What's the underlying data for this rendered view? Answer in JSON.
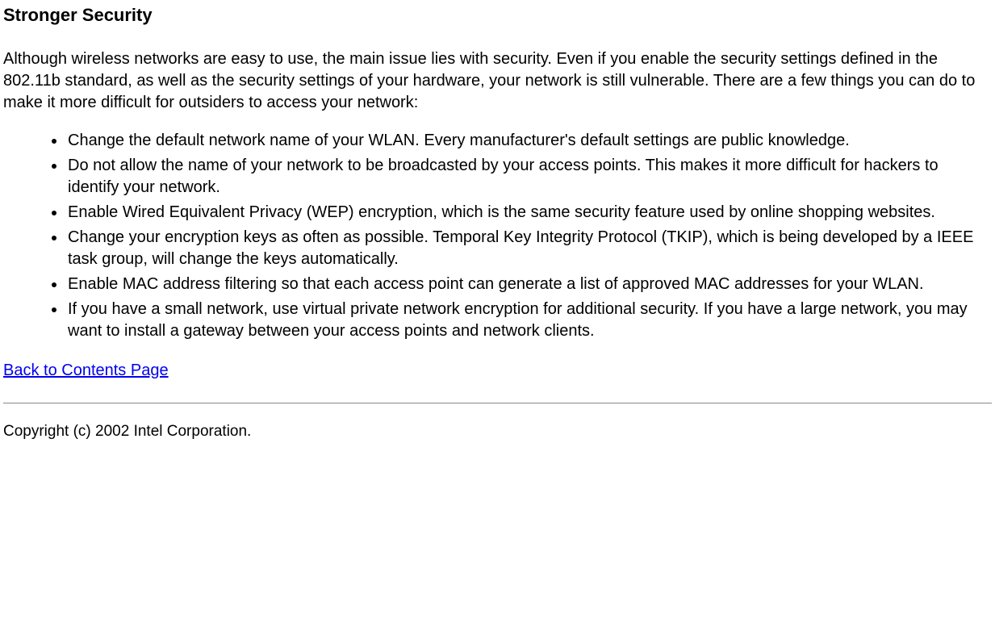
{
  "heading": "Stronger Security",
  "intro": "Although wireless networks are easy to use, the main issue lies with security. Even if you enable the security settings defined in the 802.11b standard, as well as the security settings of your hardware, your network is still vulnerable. There are a few things you can do to make it more difficult for outsiders to access your network:",
  "bullets": [
    "Change the default network name of your WLAN. Every manufacturer's default settings are public knowledge.",
    "Do not allow the name of your network to be broadcasted by your access points. This makes it more difficult for hackers to identify your network.",
    "Enable Wired Equivalent Privacy (WEP) encryption, which is the same security feature used by online shopping websites.",
    "Change your encryption keys as often as possible. Temporal Key Integrity Protocol (TKIP), which is being developed by a IEEE task group, will change the keys automatically.",
    "Enable MAC address filtering so that each access point can generate a list of approved MAC addresses for your WLAN.",
    "If you have a small network, use virtual private network encryption for additional security. If you have a large network, you may want to install a gateway between your access points and network clients."
  ],
  "back_link": "Back to Contents Page",
  "copyright": "Copyright (c) 2002 Intel Corporation."
}
